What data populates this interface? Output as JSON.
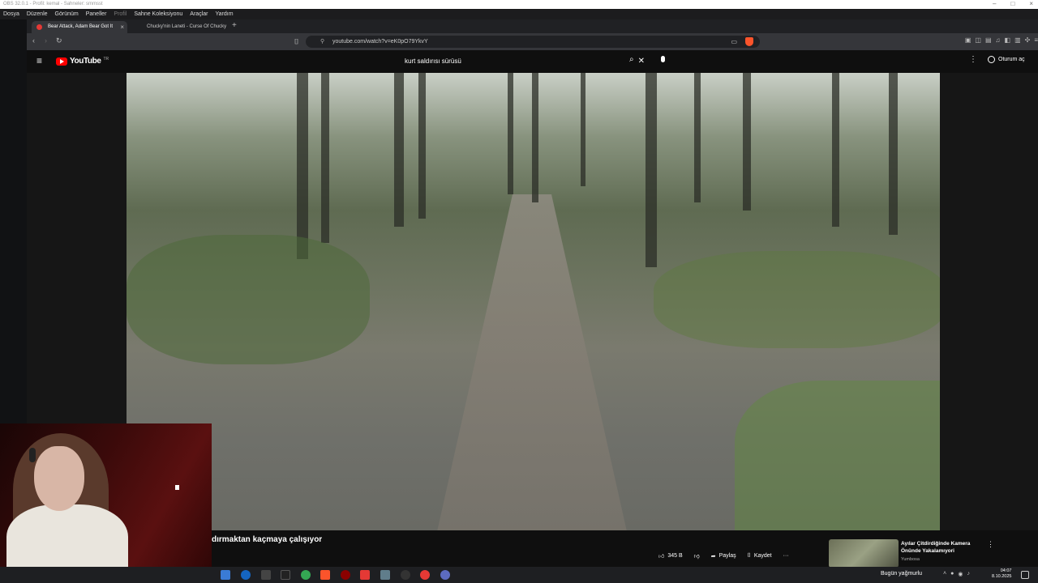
{
  "obs": {
    "title": "OBS 32.0.1 - Profil: kemal - Sahneler: smmsst",
    "menu": [
      "Dosya",
      "Düzenle",
      "Görünüm",
      "Paneller",
      "Profil",
      "Sahne Koleksiyonu",
      "Araçlar",
      "Yardım"
    ],
    "window_controls": [
      "–",
      "□",
      "×"
    ]
  },
  "browser": {
    "tabs": [
      {
        "label": "Bear Attack, Adam Bear Got It",
        "active": true
      },
      {
        "label": "Chucky'nin Laneti - Curse Of Chucky",
        "active": false
      }
    ],
    "new_tab": "+",
    "url": "youtube.com/watch?v=eK0pO79YkvY"
  },
  "youtube": {
    "logo_text": "YouTube",
    "logo_tm": "TR",
    "search_query": "kurt saldırısı sürüsü",
    "sign_in": "Oturum aç",
    "video_title": "dırmaktan kaçmaya çalışıyor",
    "likes": "345 B",
    "share": "Paylaş",
    "save": "Kaydet",
    "more": "···",
    "recommended": {
      "title": "Ayılar Çitdirdiğinde Kamera Önünde Yakalamıyori",
      "channel": "Yumbosa"
    }
  },
  "taskbar": {
    "weather": "Bugün yağmurlu",
    "time": "04:07",
    "date": "8.10.2025"
  },
  "colors": {
    "yt_red": "#ff0000",
    "brave_orange": "#fb542b",
    "background": "#0f0f0f"
  }
}
